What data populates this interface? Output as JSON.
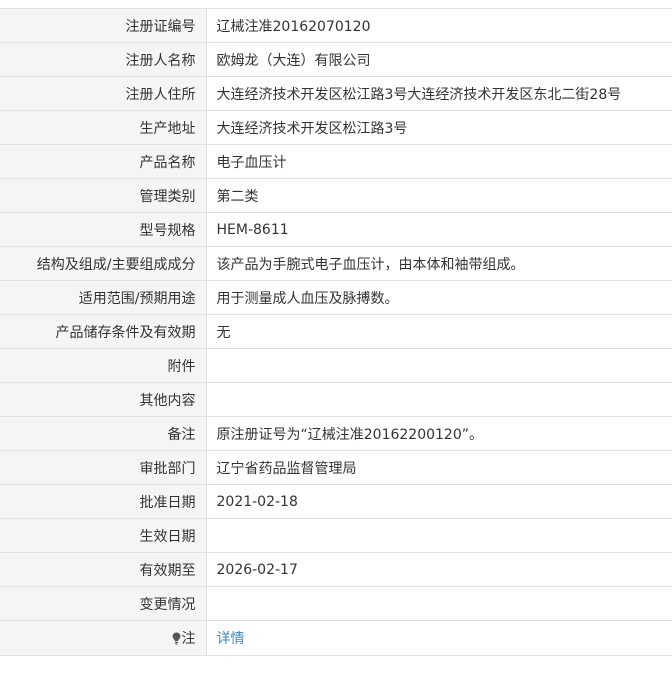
{
  "rows": [
    {
      "label": "注册证编号",
      "value": "辽械注准20162070120"
    },
    {
      "label": "注册人名称",
      "value": "欧姆龙（大连）有限公司"
    },
    {
      "label": "注册人住所",
      "value": "大连经济技术开发区松江路3号大连经济技术开发区东北二街28号"
    },
    {
      "label": "生产地址",
      "value": "大连经济技术开发区松江路3号"
    },
    {
      "label": "产品名称",
      "value": "电子血压计"
    },
    {
      "label": "管理类别",
      "value": "第二类"
    },
    {
      "label": "型号规格",
      "value": "HEM-8611"
    },
    {
      "label": "结构及组成/主要组成成分",
      "value": "该产品为手腕式电子血压计，由本体和袖带组成。"
    },
    {
      "label": "适用范围/预期用途",
      "value": "用于测量成人血压及脉搏数。"
    },
    {
      "label": "产品储存条件及有效期",
      "value": "无"
    },
    {
      "label": "附件",
      "value": ""
    },
    {
      "label": "其他内容",
      "value": ""
    },
    {
      "label": "备注",
      "value": "原注册证号为“辽械注准20162200120”。"
    },
    {
      "label": "审批部门",
      "value": "辽宁省药品监督管理局"
    },
    {
      "label": "批准日期",
      "value": "2021-02-18"
    },
    {
      "label": "生效日期",
      "value": ""
    },
    {
      "label": "有效期至",
      "value": "2026-02-17"
    },
    {
      "label": "变更情况",
      "value": ""
    }
  ],
  "note": {
    "icon": "lightbulb-icon",
    "label": "注",
    "link_text": "详情"
  },
  "colors": {
    "label_bg": "#f5f5f5",
    "border": "#e1e1e1",
    "link": "#3a87c8",
    "text": "#333333"
  }
}
